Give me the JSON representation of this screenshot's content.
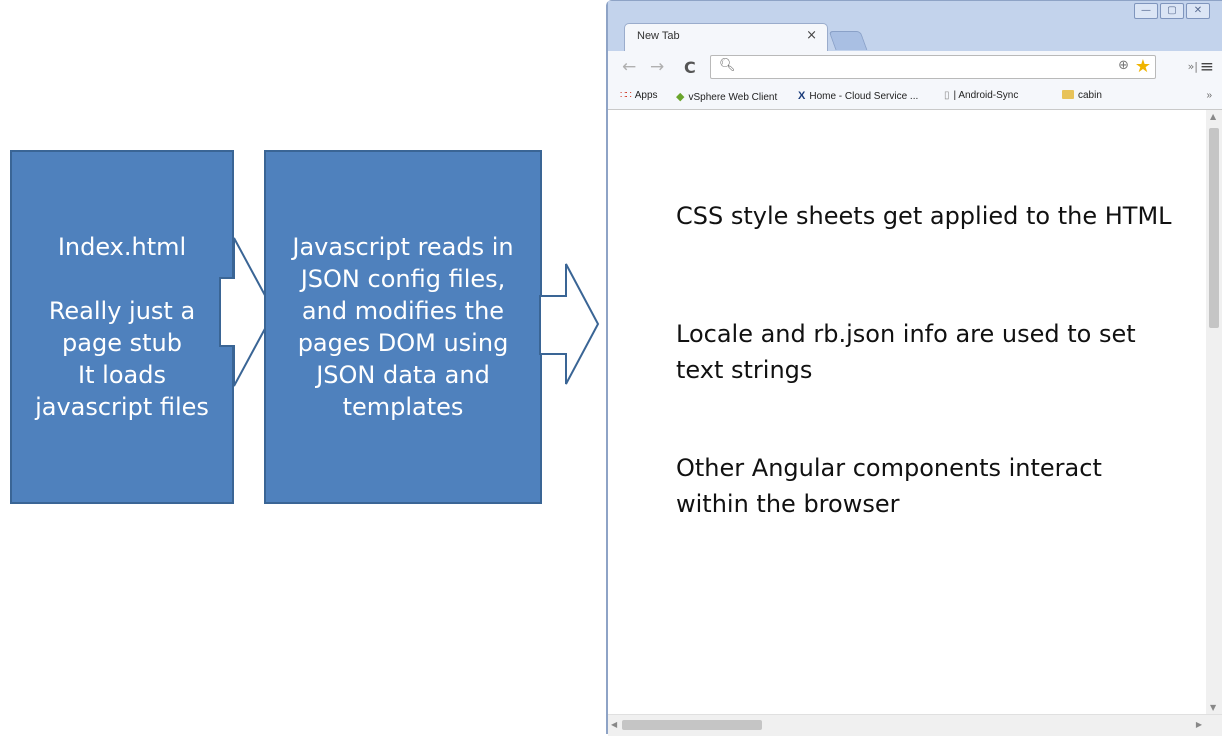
{
  "diagram": {
    "box1": {
      "title": "Index.html",
      "lines": [
        "Really just a",
        "page stub",
        "It loads",
        "javascript files"
      ]
    },
    "box2": {
      "lines": [
        "Javascript reads in",
        "JSON config files,",
        "and modifies the",
        "pages DOM using",
        "JSON data and",
        "templates"
      ]
    }
  },
  "browser": {
    "tab_title": "New Tab",
    "tab_close": "×",
    "window_buttons": {
      "minimize": "—",
      "maximize": "▢",
      "close": "✕"
    },
    "toolbar": {
      "back": "←",
      "forward": "→",
      "reload": "C",
      "address_value": "",
      "extensions": "»|",
      "menu": "≡"
    },
    "bookmarks": [
      {
        "label": "Apps",
        "icon": "apps-grid-icon"
      },
      {
        "label": "vSphere Web Client",
        "icon": "vsphere-icon"
      },
      {
        "label": "Home - Cloud Service ...",
        "icon": "cloud-service-icon"
      },
      {
        "label": "| Android-Sync",
        "icon": "page-icon"
      },
      {
        "label": "cabin",
        "icon": "folder-icon"
      }
    ],
    "bookmarks_more": "»",
    "content": {
      "paragraphs": [
        "CSS style sheets get applied to the HTML",
        "Locale and rb.json info are used to set text strings",
        "Other Angular components interact within the browser"
      ]
    }
  },
  "colors": {
    "box_fill": "#4f81bd",
    "box_border": "#3a6595",
    "arrow_outline": "#3a6595",
    "browser_frame": "#c3d3ec"
  }
}
